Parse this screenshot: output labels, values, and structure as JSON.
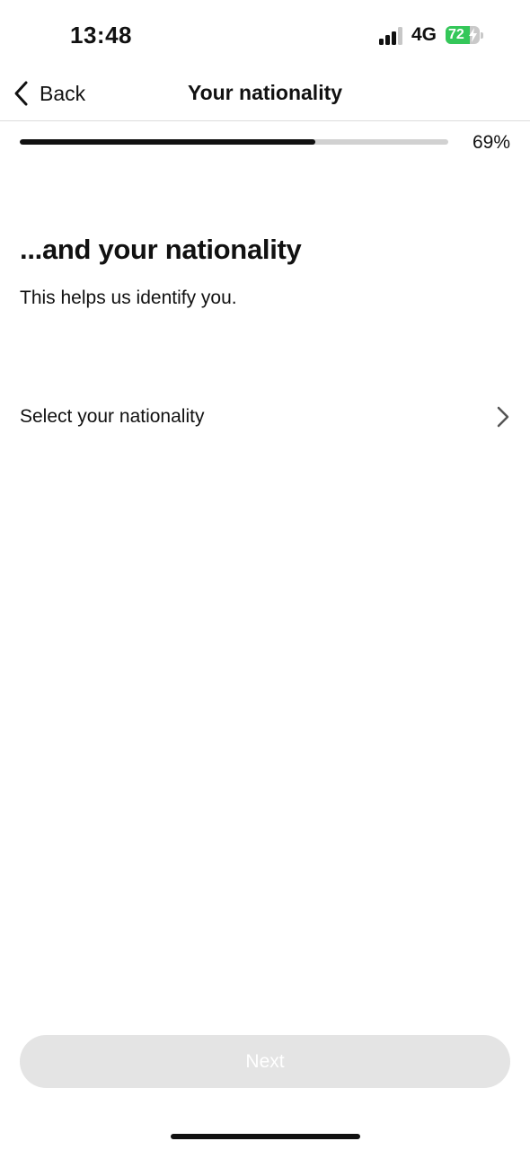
{
  "status_bar": {
    "time": "13:48",
    "network": "4G",
    "battery_percent": "72",
    "signal_level": 3,
    "signal_max": 4,
    "battery_color": "#34c759"
  },
  "nav": {
    "back_label": "Back",
    "title": "Your nationality"
  },
  "progress": {
    "value": 69,
    "label": "69%"
  },
  "content": {
    "heading": "...and your nationality",
    "subtext": "This helps us identify you.",
    "select_label": "Select your nationality"
  },
  "footer": {
    "next_label": "Next",
    "next_enabled": false
  },
  "icons": {
    "back": "chevron-left-icon",
    "select": "chevron-right-icon",
    "signal": "signal-icon",
    "battery": "battery-charging-icon"
  }
}
